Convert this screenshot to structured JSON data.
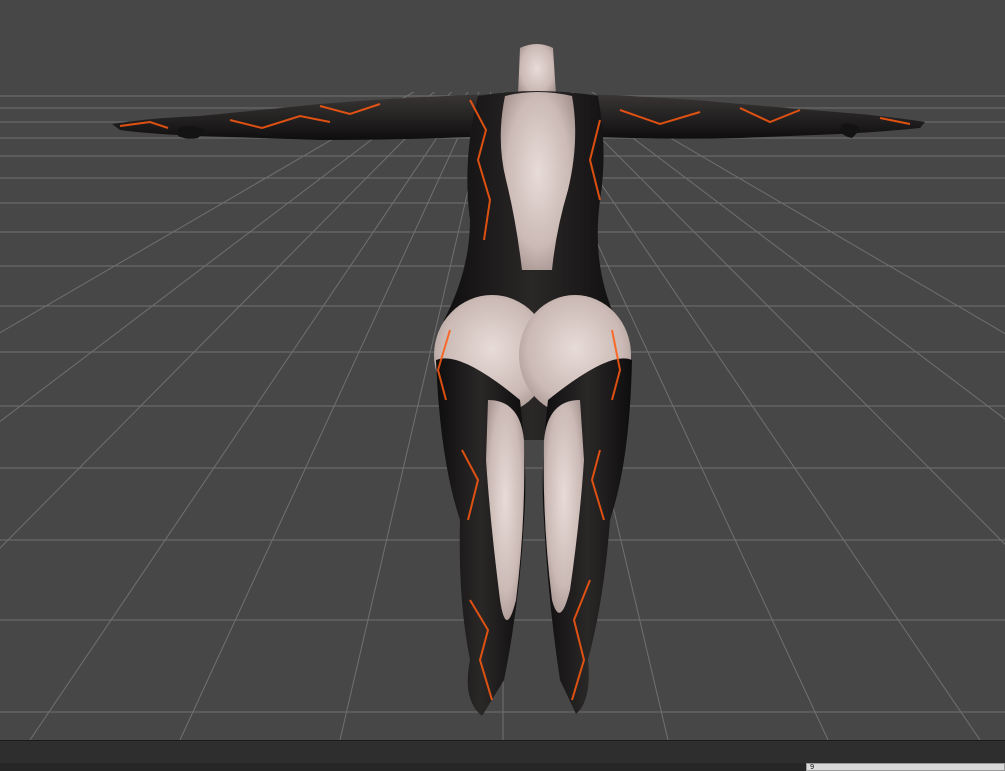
{
  "viewport": {
    "background_color": "#474747",
    "grid_color": "#7a7a7a",
    "model": "character-mesh-back-view-t-pose"
  },
  "status_bar": {
    "frame_input_value": "9"
  }
}
